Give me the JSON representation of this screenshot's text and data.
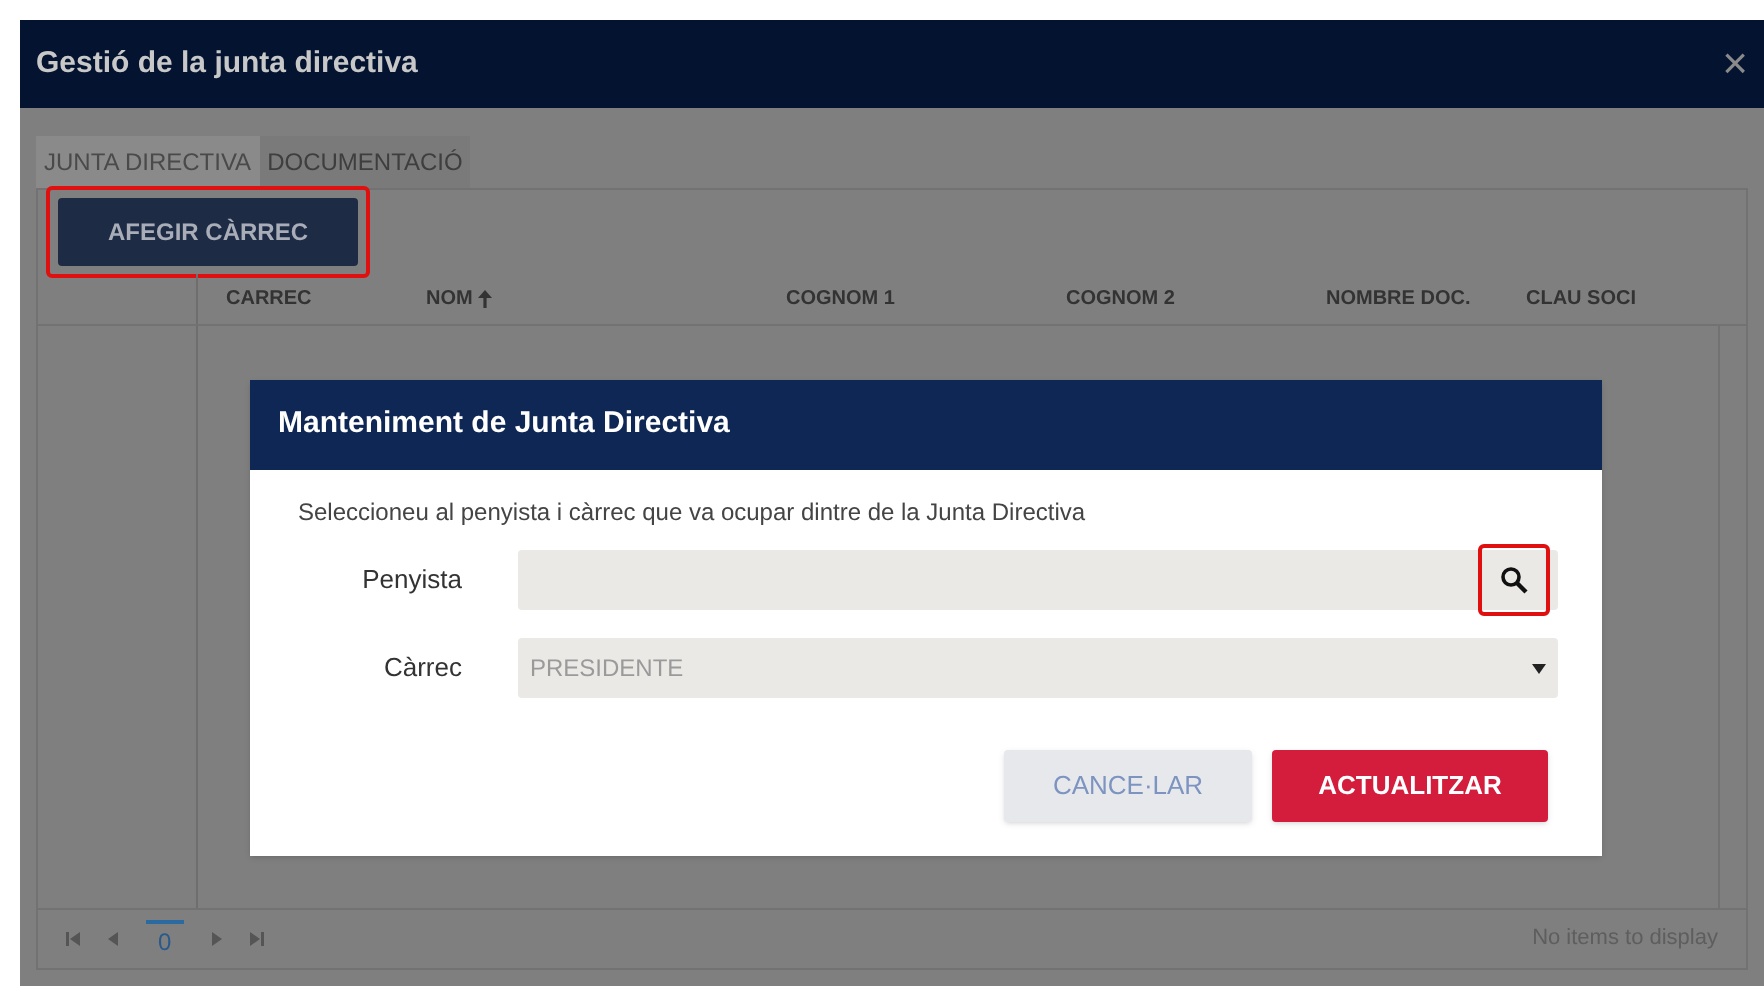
{
  "window": {
    "title": "Gestió de la junta directiva",
    "close": "×"
  },
  "tabs": [
    {
      "label": "JUNTA DIRECTIVA",
      "selected": true
    },
    {
      "label": "DOCUMENTACIÓ",
      "selected": false
    }
  ],
  "add_button": {
    "label": "AFEGIR CÀRREC",
    "highlighted": true
  },
  "table": {
    "columns": [
      {
        "label": "CARREC",
        "sorted": false
      },
      {
        "label": "NOM",
        "sorted": true
      },
      {
        "label": "COGNOM 1",
        "sorted": false
      },
      {
        "label": "COGNOM 2",
        "sorted": false
      },
      {
        "label": "NOMBRE DOC.",
        "sorted": false
      },
      {
        "label": "CLAU SOCI",
        "sorted": false
      }
    ]
  },
  "pager": {
    "page": "0",
    "status": "No items to display"
  },
  "dialog": {
    "title": "Manteniment de Junta Directiva",
    "instructions": "Seleccioneu al penyista i càrrec que va ocupar dintre de la Junta Directiva",
    "fields": [
      {
        "kind": "search",
        "label": "Penyista",
        "search_highlighted": true
      },
      {
        "kind": "select",
        "label": "Càrrec",
        "value": "PRESIDENTE"
      }
    ],
    "buttons": [
      {
        "kind": "secondary",
        "label": "CANCE·LAR"
      },
      {
        "kind": "primary",
        "label": "ACTUALITZAR"
      }
    ]
  }
}
